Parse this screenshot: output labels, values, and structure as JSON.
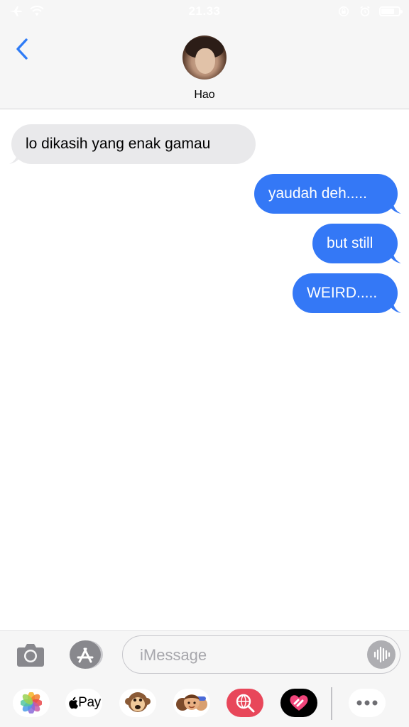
{
  "status_bar": {
    "time": "21.33",
    "icons": [
      "airplane-icon",
      "wifi-icon",
      "lock-rotation-icon",
      "alarm-icon",
      "battery-icon"
    ]
  },
  "header": {
    "back_icon": "chevron-left-icon",
    "contact_name": "Hao"
  },
  "messages": [
    {
      "direction": "incoming",
      "text": "lo dikasih yang enak gamau"
    },
    {
      "direction": "outgoing",
      "text": "yaudah deh....."
    },
    {
      "direction": "outgoing",
      "text": "but still"
    },
    {
      "direction": "outgoing",
      "text": "WEIRD....."
    }
  ],
  "composer": {
    "camera_icon": "camera-icon",
    "appstore_icon": "app-store-icon",
    "placeholder": "iMessage",
    "audio_icon": "audio-waveform-icon"
  },
  "app_tray": {
    "apps": [
      {
        "icon": "photos-icon"
      },
      {
        "icon": "apple-pay-icon",
        "label": "Pay"
      },
      {
        "icon": "animoji-monkey-icon"
      },
      {
        "icon": "memoji-icon"
      },
      {
        "icon": "search-globe-icon"
      },
      {
        "icon": "digital-touch-icon"
      },
      {
        "icon": "more-icon"
      }
    ]
  },
  "colors": {
    "outgoing_bubble": "#3478f6",
    "incoming_bubble": "#e9e9eb",
    "accent": "#2f7cf6"
  }
}
